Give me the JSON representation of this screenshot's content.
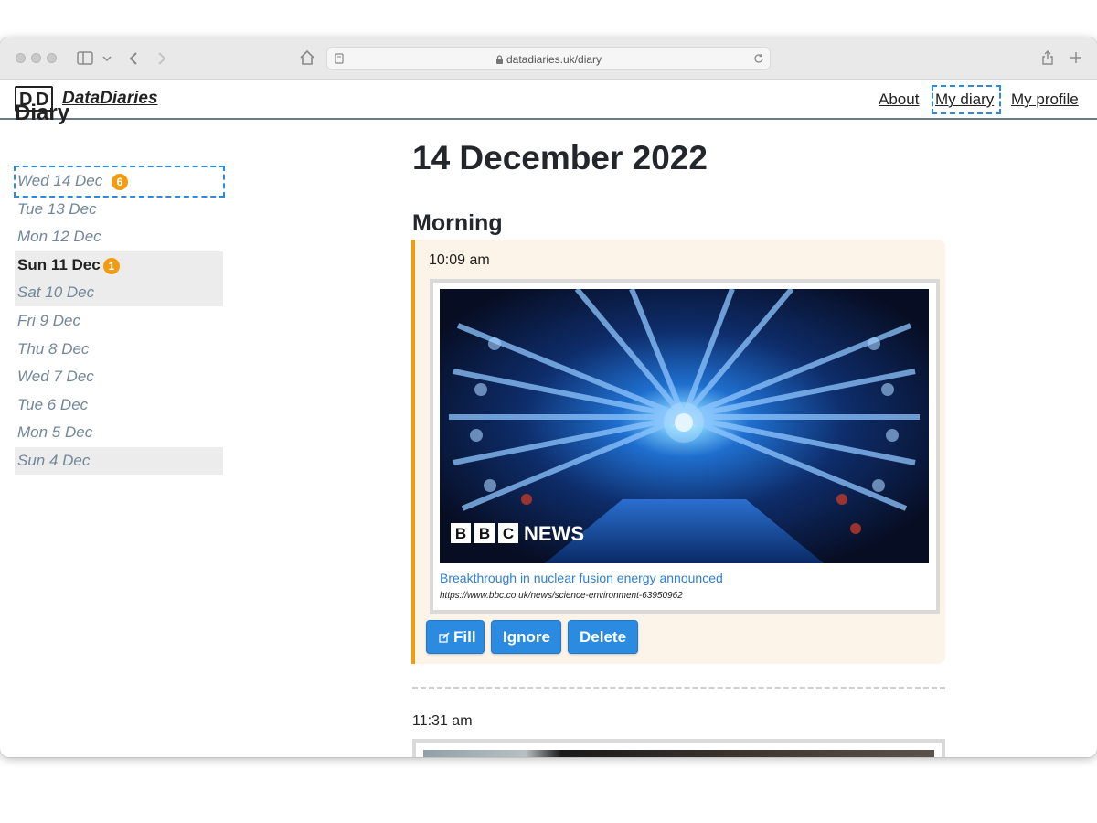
{
  "browser": {
    "url": "datadiaries.uk/diary"
  },
  "header": {
    "logo_text": "DD",
    "brand": "DataDiaries",
    "nav": [
      "About",
      "My diary",
      "My profile"
    ]
  },
  "sidebar": {
    "title": "Diary",
    "items": [
      {
        "label": "Wed 14 Dec",
        "badge": "6"
      },
      {
        "label": "Tue 13 Dec"
      },
      {
        "label": "Mon 12 Dec"
      },
      {
        "label": "Sun 11 Dec",
        "badge": "1"
      },
      {
        "label": "Sat 10 Dec"
      },
      {
        "label": "Fri 9 Dec"
      },
      {
        "label": "Thu 8 Dec"
      },
      {
        "label": "Wed 7 Dec"
      },
      {
        "label": "Tue 6 Dec"
      },
      {
        "label": "Mon 5 Dec"
      },
      {
        "label": "Sun 4 Dec"
      }
    ]
  },
  "main": {
    "date_heading": "14 December 2022",
    "section": "Morning",
    "entries": [
      {
        "time": "10:09 am",
        "image_watermark": "NEWS",
        "bbc_letters": [
          "B",
          "B",
          "C"
        ],
        "link_title": "Breakthrough in nuclear fusion energy announced",
        "link_url": "https://www.bbc.co.uk/news/science-environment-63950962",
        "buttons": {
          "fill": "Fill",
          "ignore": "Ignore",
          "delete": "Delete"
        }
      },
      {
        "time": "11:31 am"
      }
    ]
  },
  "colors": {
    "accent_blue": "#2b8be0",
    "badge_orange": "#f39c12",
    "entry_bg": "#fdf4e9"
  }
}
